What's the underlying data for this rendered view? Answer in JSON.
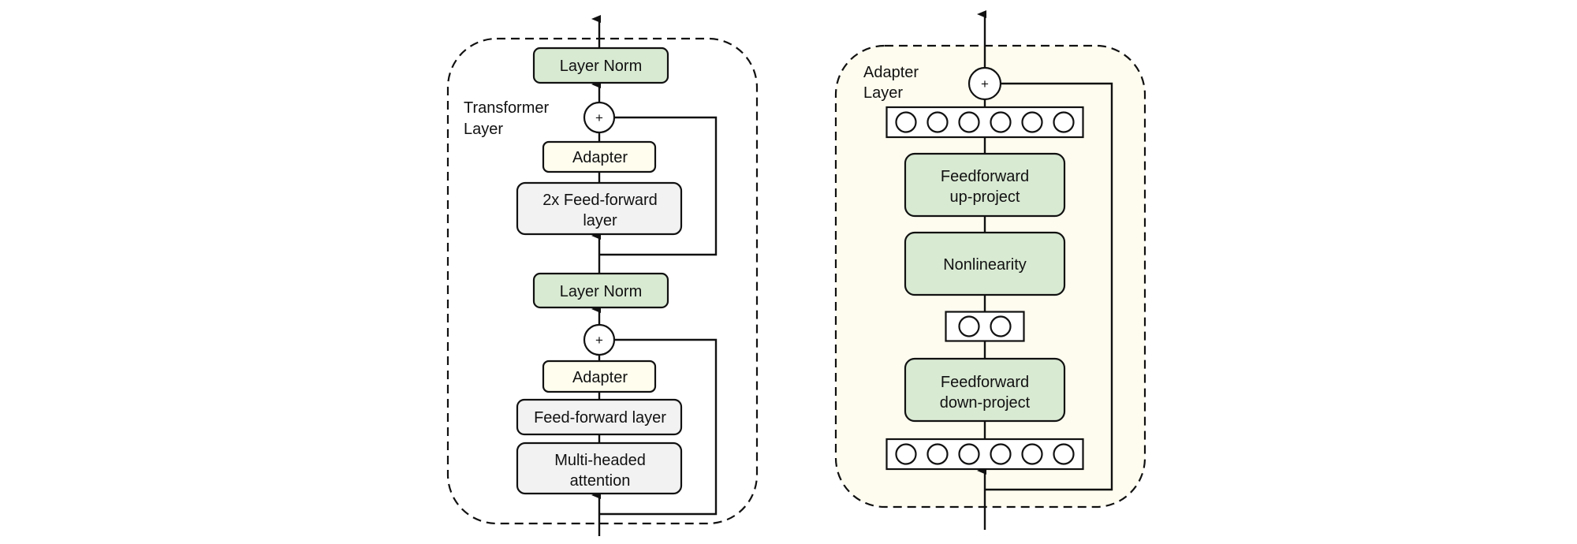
{
  "colors": {
    "green_block": "#d9ead3",
    "yellow_block": "#fffdee",
    "gray_block": "#f2f2f2",
    "adapter_panel_bg": "#fefcef",
    "stroke": "#111111"
  },
  "transformer_layer": {
    "panel_label": [
      "Transformer",
      "Layer"
    ],
    "blocks": [
      {
        "id": "layer-norm-top",
        "lines": [
          "Layer Norm"
        ],
        "fill": "green_block"
      },
      {
        "id": "adapter-top",
        "lines": [
          "Adapter"
        ],
        "fill": "yellow_block"
      },
      {
        "id": "feed-forward-2x",
        "lines": [
          "2x Feed-forward",
          "layer"
        ],
        "fill": "gray_block"
      },
      {
        "id": "layer-norm-bottom",
        "lines": [
          "Layer Norm"
        ],
        "fill": "green_block"
      },
      {
        "id": "adapter-bottom",
        "lines": [
          "Adapter"
        ],
        "fill": "yellow_block"
      },
      {
        "id": "feed-forward",
        "lines": [
          "Feed-forward layer"
        ],
        "fill": "gray_block"
      },
      {
        "id": "multi-headed-attention",
        "lines": [
          "Multi-headed",
          "attention"
        ],
        "fill": "gray_block"
      }
    ],
    "add_symbol": "+"
  },
  "adapter_layer": {
    "panel_label": [
      "Adapter",
      "Layer"
    ],
    "blocks": [
      {
        "id": "feedforward-up-project",
        "lines": [
          "Feedforward",
          "up-project"
        ],
        "fill": "green_block"
      },
      {
        "id": "nonlinearity",
        "lines": [
          "Nonlinearity"
        ],
        "fill": "green_block"
      },
      {
        "id": "feedforward-down-project",
        "lines": [
          "Feedforward",
          "down-project"
        ],
        "fill": "green_block"
      }
    ],
    "neuron_layers": [
      {
        "id": "output-neurons",
        "count": 6
      },
      {
        "id": "bottleneck-neurons",
        "count": 2
      },
      {
        "id": "input-neurons",
        "count": 6
      }
    ],
    "add_symbol": "+"
  }
}
